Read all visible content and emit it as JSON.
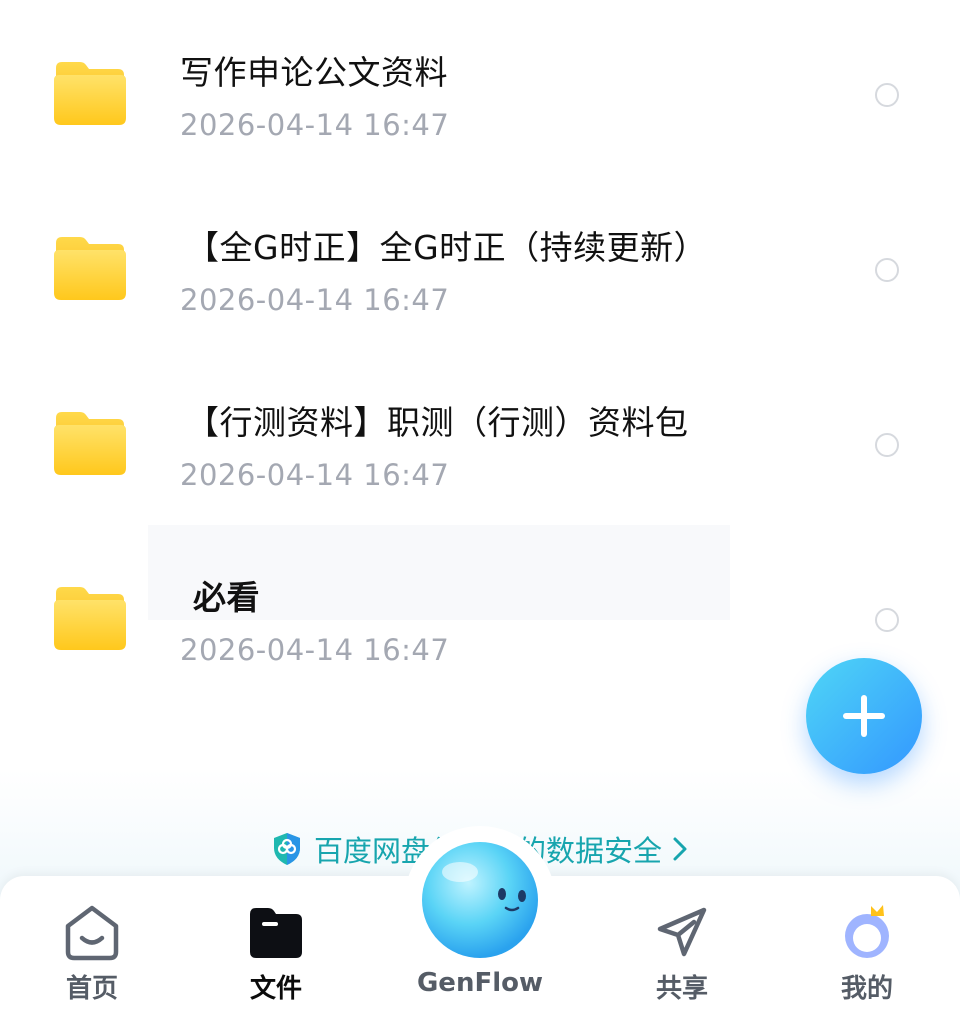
{
  "files": [
    {
      "name": "写作申论公文资料",
      "date": "2026-04-14  16:47",
      "icon": "folder-icon"
    },
    {
      "name": "【全G时正】全G时正（持续更新）",
      "date": "2026-04-14  16:47",
      "icon": "folder-icon"
    },
    {
      "name": "【行测资料】职测（行测）资料包",
      "date": "2026-04-14  16:47",
      "icon": "folder-icon"
    },
    {
      "name": "必看",
      "date": "2026-04-14  16:47",
      "icon": "folder-icon"
    }
  ],
  "security_banner": {
    "text": "百度网盘保护你的数据安全",
    "icon": "shield-icon"
  },
  "fab": {
    "icon": "plus-icon"
  },
  "tabs": [
    {
      "label": "首页",
      "icon": "home-icon"
    },
    {
      "label": "文件",
      "icon": "folder-icon",
      "active": true
    },
    {
      "label": "GenFlow",
      "icon": "genflow-orb-icon"
    },
    {
      "label": "共享",
      "icon": "send-icon"
    },
    {
      "label": "我的",
      "icon": "profile-icon"
    }
  ],
  "colors": {
    "folder": "#ffd33d",
    "accent": "#3397ff",
    "security_text": "#17a5ae",
    "date_text": "#a4a8b2"
  }
}
